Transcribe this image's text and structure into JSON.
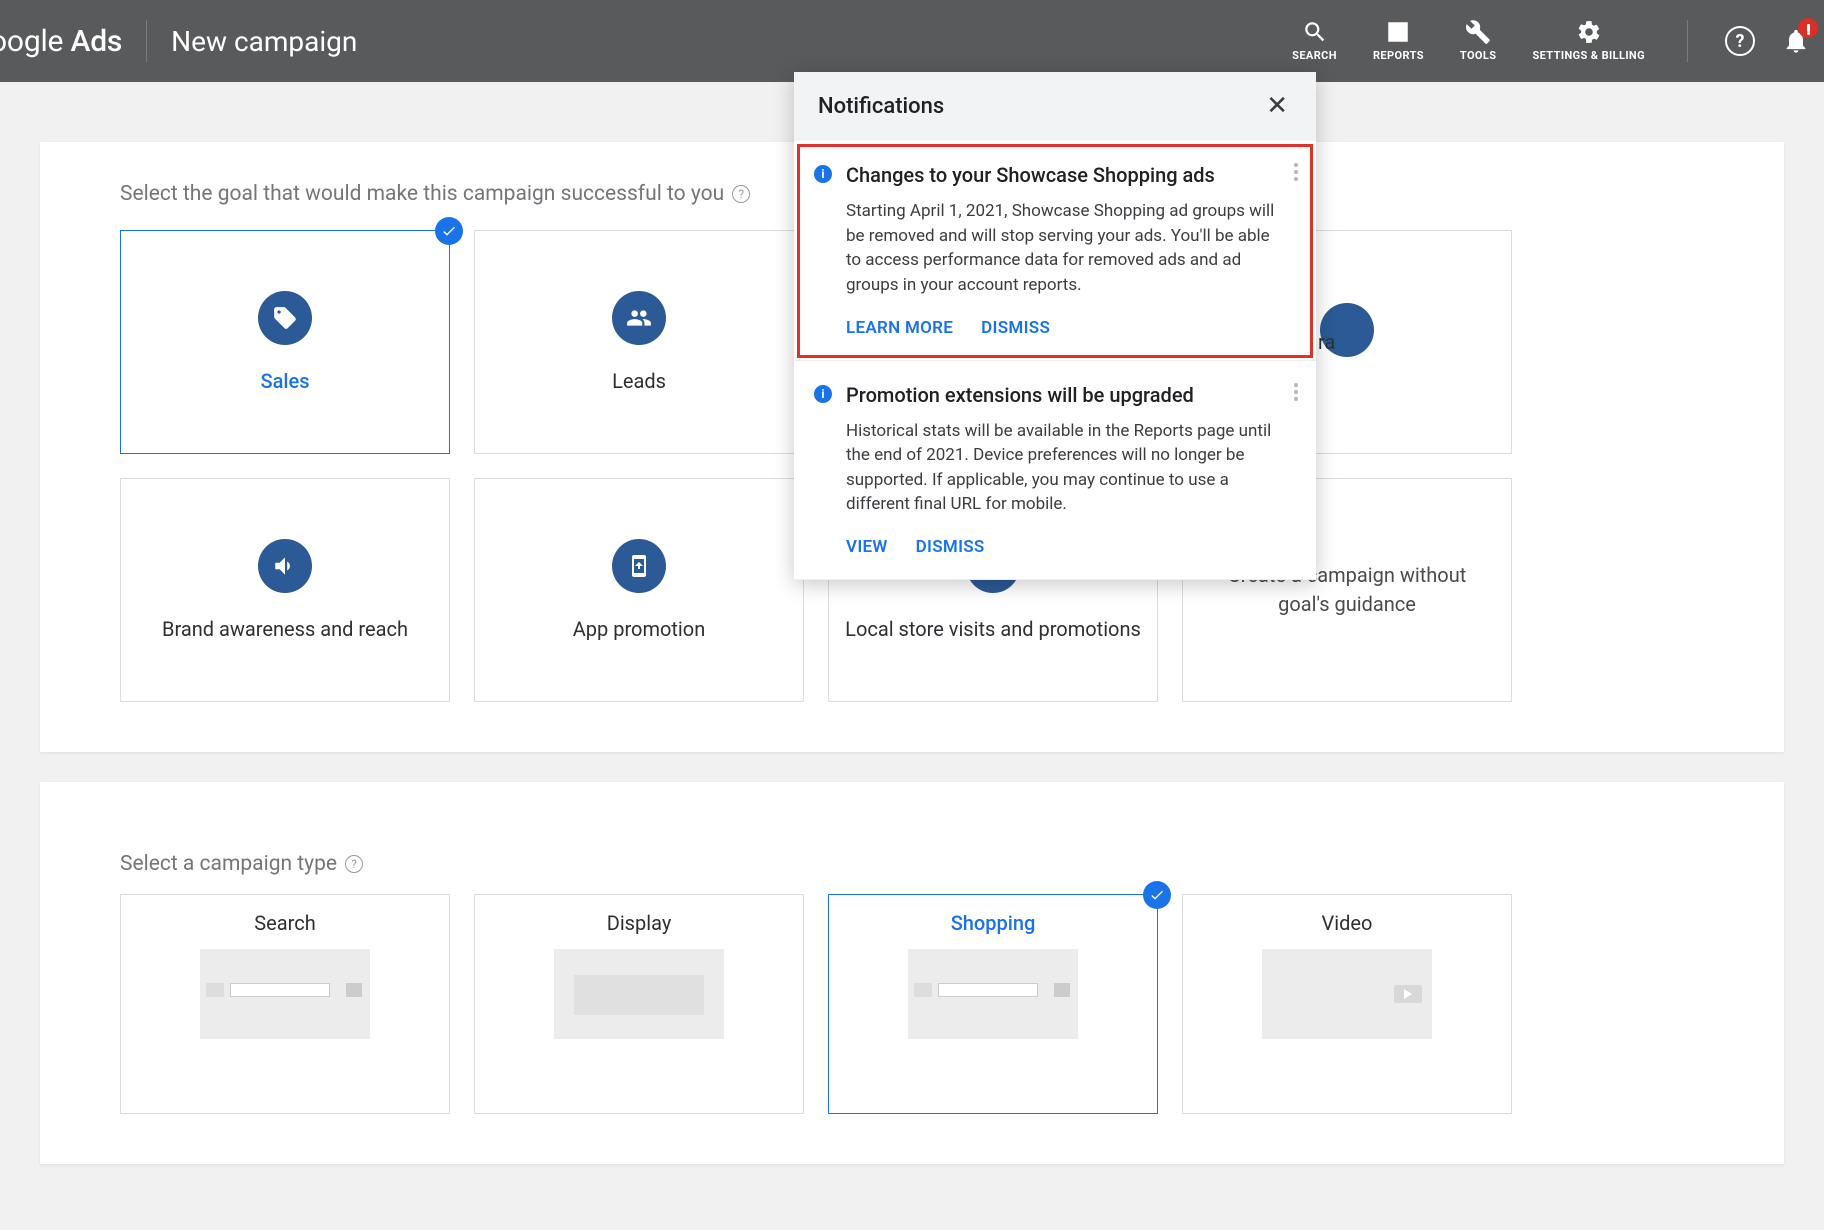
{
  "header": {
    "logo_prefix": "oogle",
    "logo_suffix": "Ads",
    "page_title": "New campaign",
    "nav": {
      "search": "SEARCH",
      "reports": "REPORTS",
      "tools": "TOOLS",
      "settings": "SETTINGS & BILLING"
    }
  },
  "goals": {
    "heading": "Select the goal that would make this campaign successful to you",
    "items": [
      {
        "label": "Sales"
      },
      {
        "label": "Leads"
      },
      {
        "label": ""
      },
      {
        "label": ""
      },
      {
        "label": "Brand awareness and reach"
      },
      {
        "label": "App promotion"
      },
      {
        "label": "Local store visits and promotions"
      }
    ],
    "noguide_line1": "Create a campaign without",
    "noguide_line2": "goal's guidance"
  },
  "campaign_types": {
    "heading": "Select a campaign type",
    "items": [
      {
        "label": "Search"
      },
      {
        "label": "Display"
      },
      {
        "label": "Shopping"
      },
      {
        "label": "Video"
      }
    ]
  },
  "notifications": {
    "title": "Notifications",
    "items": [
      {
        "title": "Changes to your Showcase Shopping ads",
        "body": "Starting April 1, 2021, Showcase Shopping ad groups will be removed and will stop serving your ads. You'll be able to access performance data for removed ads and ad groups in your account reports.",
        "action1": "LEARN MORE",
        "action2": "DISMISS"
      },
      {
        "title": "Promotion extensions will be upgraded",
        "body": "Historical stats will be available in the Reports page until the end of 2021. Device preferences will no longer be supported. If applicable, you may continue to use a different final URL for mobile.",
        "action1": "VIEW",
        "action2": "DISMISS"
      }
    ]
  },
  "overflow_fragment": "ra"
}
